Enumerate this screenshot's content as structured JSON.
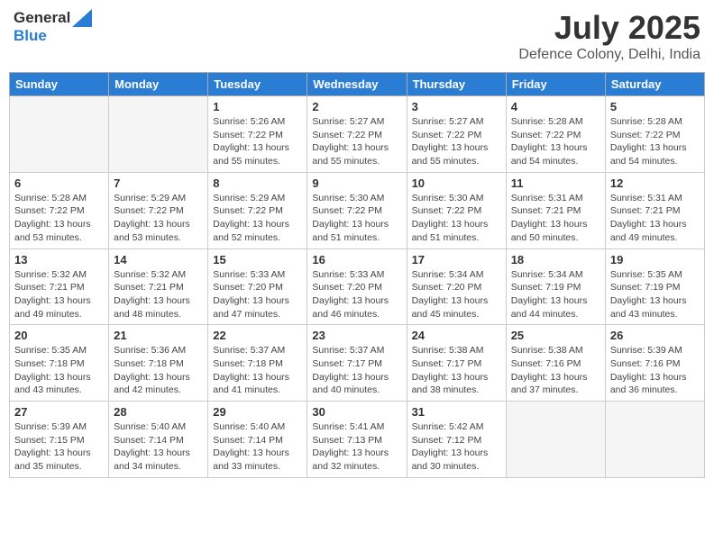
{
  "logo": {
    "line1": "General",
    "line2": "Blue"
  },
  "title": "July 2025",
  "subtitle": "Defence Colony, Delhi, India",
  "header_days": [
    "Sunday",
    "Monday",
    "Tuesday",
    "Wednesday",
    "Thursday",
    "Friday",
    "Saturday"
  ],
  "weeks": [
    [
      {
        "day": "",
        "info": ""
      },
      {
        "day": "",
        "info": ""
      },
      {
        "day": "1",
        "info": "Sunrise: 5:26 AM\nSunset: 7:22 PM\nDaylight: 13 hours and 55 minutes."
      },
      {
        "day": "2",
        "info": "Sunrise: 5:27 AM\nSunset: 7:22 PM\nDaylight: 13 hours and 55 minutes."
      },
      {
        "day": "3",
        "info": "Sunrise: 5:27 AM\nSunset: 7:22 PM\nDaylight: 13 hours and 55 minutes."
      },
      {
        "day": "4",
        "info": "Sunrise: 5:28 AM\nSunset: 7:22 PM\nDaylight: 13 hours and 54 minutes."
      },
      {
        "day": "5",
        "info": "Sunrise: 5:28 AM\nSunset: 7:22 PM\nDaylight: 13 hours and 54 minutes."
      }
    ],
    [
      {
        "day": "6",
        "info": "Sunrise: 5:28 AM\nSunset: 7:22 PM\nDaylight: 13 hours and 53 minutes."
      },
      {
        "day": "7",
        "info": "Sunrise: 5:29 AM\nSunset: 7:22 PM\nDaylight: 13 hours and 53 minutes."
      },
      {
        "day": "8",
        "info": "Sunrise: 5:29 AM\nSunset: 7:22 PM\nDaylight: 13 hours and 52 minutes."
      },
      {
        "day": "9",
        "info": "Sunrise: 5:30 AM\nSunset: 7:22 PM\nDaylight: 13 hours and 51 minutes."
      },
      {
        "day": "10",
        "info": "Sunrise: 5:30 AM\nSunset: 7:22 PM\nDaylight: 13 hours and 51 minutes."
      },
      {
        "day": "11",
        "info": "Sunrise: 5:31 AM\nSunset: 7:21 PM\nDaylight: 13 hours and 50 minutes."
      },
      {
        "day": "12",
        "info": "Sunrise: 5:31 AM\nSunset: 7:21 PM\nDaylight: 13 hours and 49 minutes."
      }
    ],
    [
      {
        "day": "13",
        "info": "Sunrise: 5:32 AM\nSunset: 7:21 PM\nDaylight: 13 hours and 49 minutes."
      },
      {
        "day": "14",
        "info": "Sunrise: 5:32 AM\nSunset: 7:21 PM\nDaylight: 13 hours and 48 minutes."
      },
      {
        "day": "15",
        "info": "Sunrise: 5:33 AM\nSunset: 7:20 PM\nDaylight: 13 hours and 47 minutes."
      },
      {
        "day": "16",
        "info": "Sunrise: 5:33 AM\nSunset: 7:20 PM\nDaylight: 13 hours and 46 minutes."
      },
      {
        "day": "17",
        "info": "Sunrise: 5:34 AM\nSunset: 7:20 PM\nDaylight: 13 hours and 45 minutes."
      },
      {
        "day": "18",
        "info": "Sunrise: 5:34 AM\nSunset: 7:19 PM\nDaylight: 13 hours and 44 minutes."
      },
      {
        "day": "19",
        "info": "Sunrise: 5:35 AM\nSunset: 7:19 PM\nDaylight: 13 hours and 43 minutes."
      }
    ],
    [
      {
        "day": "20",
        "info": "Sunrise: 5:35 AM\nSunset: 7:18 PM\nDaylight: 13 hours and 43 minutes."
      },
      {
        "day": "21",
        "info": "Sunrise: 5:36 AM\nSunset: 7:18 PM\nDaylight: 13 hours and 42 minutes."
      },
      {
        "day": "22",
        "info": "Sunrise: 5:37 AM\nSunset: 7:18 PM\nDaylight: 13 hours and 41 minutes."
      },
      {
        "day": "23",
        "info": "Sunrise: 5:37 AM\nSunset: 7:17 PM\nDaylight: 13 hours and 40 minutes."
      },
      {
        "day": "24",
        "info": "Sunrise: 5:38 AM\nSunset: 7:17 PM\nDaylight: 13 hours and 38 minutes."
      },
      {
        "day": "25",
        "info": "Sunrise: 5:38 AM\nSunset: 7:16 PM\nDaylight: 13 hours and 37 minutes."
      },
      {
        "day": "26",
        "info": "Sunrise: 5:39 AM\nSunset: 7:16 PM\nDaylight: 13 hours and 36 minutes."
      }
    ],
    [
      {
        "day": "27",
        "info": "Sunrise: 5:39 AM\nSunset: 7:15 PM\nDaylight: 13 hours and 35 minutes."
      },
      {
        "day": "28",
        "info": "Sunrise: 5:40 AM\nSunset: 7:14 PM\nDaylight: 13 hours and 34 minutes."
      },
      {
        "day": "29",
        "info": "Sunrise: 5:40 AM\nSunset: 7:14 PM\nDaylight: 13 hours and 33 minutes."
      },
      {
        "day": "30",
        "info": "Sunrise: 5:41 AM\nSunset: 7:13 PM\nDaylight: 13 hours and 32 minutes."
      },
      {
        "day": "31",
        "info": "Sunrise: 5:42 AM\nSunset: 7:12 PM\nDaylight: 13 hours and 30 minutes."
      },
      {
        "day": "",
        "info": ""
      },
      {
        "day": "",
        "info": ""
      }
    ]
  ]
}
